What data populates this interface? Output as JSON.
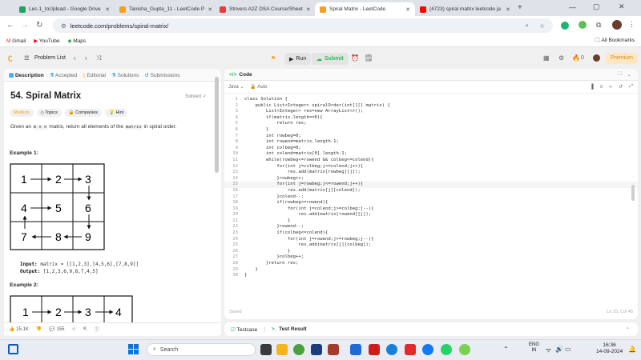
{
  "tabs": [
    {
      "title": "Lec-1_toUpload - Google Drive",
      "fav": "#1ea362",
      "active": false
    },
    {
      "title": "Tanisha_Gupta_11 - LeetCode P",
      "fav": "#f89f1b",
      "active": false
    },
    {
      "title": "Strivers A2Z DSA Course/Sheet",
      "fav": "#e43d3d",
      "active": false
    },
    {
      "title": "Spiral Matrix - LeetCode",
      "fav": "#f89f1b",
      "active": true
    },
    {
      "title": "(4723) spiral matrix leetcode ja",
      "fav": "#ff0000",
      "active": false
    }
  ],
  "url": "leetcode.com/problems/spiral-matrix/",
  "bookmarks": [
    "Gmail",
    "YouTube",
    "Maps"
  ],
  "all_bookmarks": "All Bookmarks",
  "lcnav": {
    "problem_list": "Problem List",
    "run": "Run",
    "submit": "Submit",
    "zero": "0",
    "premium": "Premium"
  },
  "left_tabs": [
    "Description",
    "Accepted",
    "Editorial",
    "Solutions",
    "Submissions"
  ],
  "problem": {
    "title": "54. Spiral Matrix",
    "solved": "Solved",
    "difficulty": "Medium",
    "tags": [
      "Topics",
      "Companies",
      "Hint"
    ],
    "desc_pre": "Given an ",
    "desc_code1": "m x n",
    "desc_mid": " matrix",
    "desc_code2": "matrix",
    "desc_post": ", return all elements of the ",
    "desc_end": " in spiral order."
  },
  "example1": {
    "heading": "Example 1:",
    "grid": [
      "1",
      "2",
      "3",
      "4",
      "5",
      "6",
      "7",
      "8",
      "9"
    ],
    "input_label": "Input:",
    "input_value": "matrix = [[1,2,3],[4,5,6],[7,8,9]]",
    "output_label": "Output:",
    "output_value": "[1,2,3,6,9,8,7,4,5]"
  },
  "example2": {
    "heading": "Example 2:",
    "grid": [
      "1",
      "2",
      "3",
      "4"
    ]
  },
  "left_footer": {
    "likes": "15.1K",
    "comments": "155"
  },
  "code_header": "Code",
  "lang": "Java",
  "auto": "Auto",
  "code_lines": [
    "class Solution {",
    "    public List<Integer> spiralOrder(int[][] matrix) {",
    "        List<Integer> res=new ArrayList<>();",
    "        if(matrix.length==0){",
    "            return res;",
    "        }",
    "        int rowbeg=0;",
    "        int rowend=matrix.length-1;",
    "        int colbeg=0;",
    "        int colend=matrix[0].length-1;",
    "        while(rowbeg<=rowend && colbeg<=colend){",
    "            for(int j=colbeg;j<=colend;j++){",
    "                res.add(matrix[rowbeg][j]);",
    "            }rowbeg++;",
    "            for(int j=rowbeg;j<=rowend;j++){",
    "                res.add(matrix[j][colend]);",
    "            }colend--;",
    "            if(rowbeg<=rowend){",
    "                for(int j=colend;j>=colbeg;j--){",
    "                    res.add(matrix[rowend][j]);",
    "                }",
    "            }rowend--;",
    "            if(colbeg<=colend){",
    "                for(int j=rowend;j>=rowbeg;j--){",
    "                    res.add(matrix[j][colbeg]);",
    "                }",
    "            }colbeg++;",
    "        }return res;",
    "    }",
    "}"
  ],
  "saved": "Saved",
  "cursor_pos": "Ln 15, Col 45",
  "bottom": {
    "testcase": "Testcase",
    "result": "Test Result"
  },
  "taskbar": {
    "search": "Search",
    "lang1": "ENG",
    "lang2": "IN",
    "time": "16:36",
    "date": "14-09-2024"
  }
}
